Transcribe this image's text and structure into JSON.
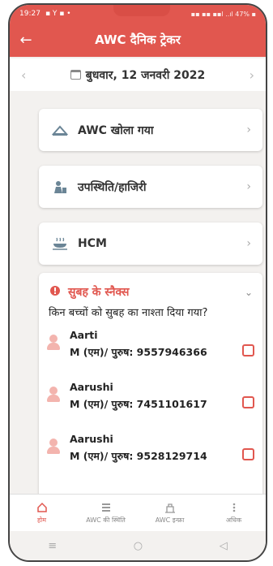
{
  "status": {
    "time": "19:27",
    "indicators": "▪ Y ▪ •",
    "right": "▪▪ ▪▪ ▪▪l ..ıl 47% ▪"
  },
  "appbar": {
    "title": "AWC दैनिक ट्रेकर",
    "back_icon": "arrow-left-icon"
  },
  "datebar": {
    "date": "बुधवार, 12 जनवरी 2022"
  },
  "cards": [
    {
      "label": "AWC खोला गया",
      "icon": "awc-open-icon"
    },
    {
      "label": "उपस्थिति/हाजिरी",
      "icon": "attendance-icon"
    },
    {
      "label": "HCM",
      "icon": "hcm-icon"
    }
  ],
  "snacks": {
    "title": "सुबह के स्नैक्स",
    "question": "किन बच्चों को सुबह का नाश्ता दिया गया?",
    "children": [
      {
        "name": "Aarti",
        "detail": "M (एम)/ पुरुष: 9557946366"
      },
      {
        "name": "Aarushi",
        "detail": "M (एम)/ पुरुष: 7451101617"
      },
      {
        "name": "Aarushi",
        "detail": "M (एम)/ पुरुष: 9528129714"
      }
    ]
  },
  "nav": [
    {
      "label": "होम",
      "icon": "home-icon"
    },
    {
      "label": "AWC की स्थिति",
      "icon": "awc-status-icon"
    },
    {
      "label": "AWC इन्फ्रा",
      "icon": "awc-infra-icon"
    },
    {
      "label": "अधिक",
      "icon": "more-icon"
    }
  ],
  "colors": {
    "accent": "#e1574f",
    "background": "#f3f1ef"
  }
}
